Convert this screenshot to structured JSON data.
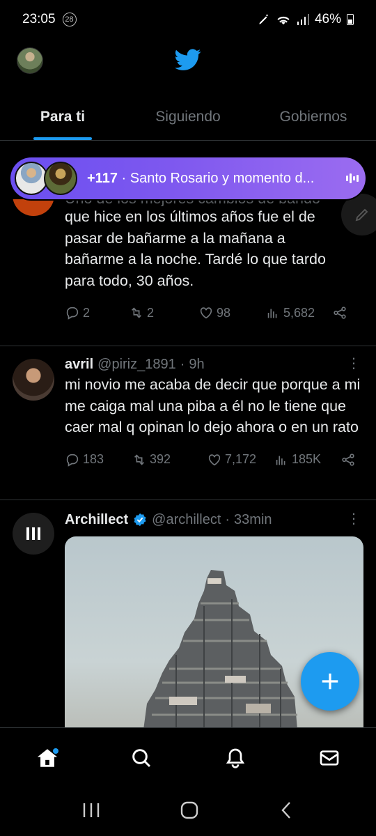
{
  "status_bar": {
    "time": "23:05",
    "notification_count": "28",
    "battery_percent": "46%"
  },
  "header": {
    "logo": "twitter-bird-icon"
  },
  "tabs": [
    {
      "label": "Para ti",
      "active": true
    },
    {
      "label": "Siguiendo",
      "active": false
    },
    {
      "label": "Gobiernos",
      "active": false
    }
  ],
  "space_pill": {
    "count": "+117",
    "title": "Santo Rosario y momento d..."
  },
  "tweets": [
    {
      "partial_line": "Uno de los mejores cambios de bando",
      "text": "que hice en los últimos años fue el de pasar de bañarme a la mañana a bañarme a la noche. Tardé lo que tardo para todo, 30 años.",
      "replies": "2",
      "retweets": "2",
      "likes": "98",
      "views": "5,682"
    },
    {
      "name": "avril",
      "handle": "@piriz_1891",
      "time": "9h",
      "text": "mi novio me acaba de decir que porque a mi me caiga mal una piba a él no le tiene que caer mal q opinan lo dejo ahora o en un rato",
      "replies": "183",
      "retweets": "392",
      "likes": "7,172",
      "views": "185K"
    },
    {
      "name": "Archillect",
      "handle": "@archillect",
      "time": "33min",
      "verified": true
    }
  ],
  "colors": {
    "accent": "#1d9bf0",
    "space_gradient_start": "#6b4ff0",
    "space_gradient_end": "#9b6cf0"
  }
}
